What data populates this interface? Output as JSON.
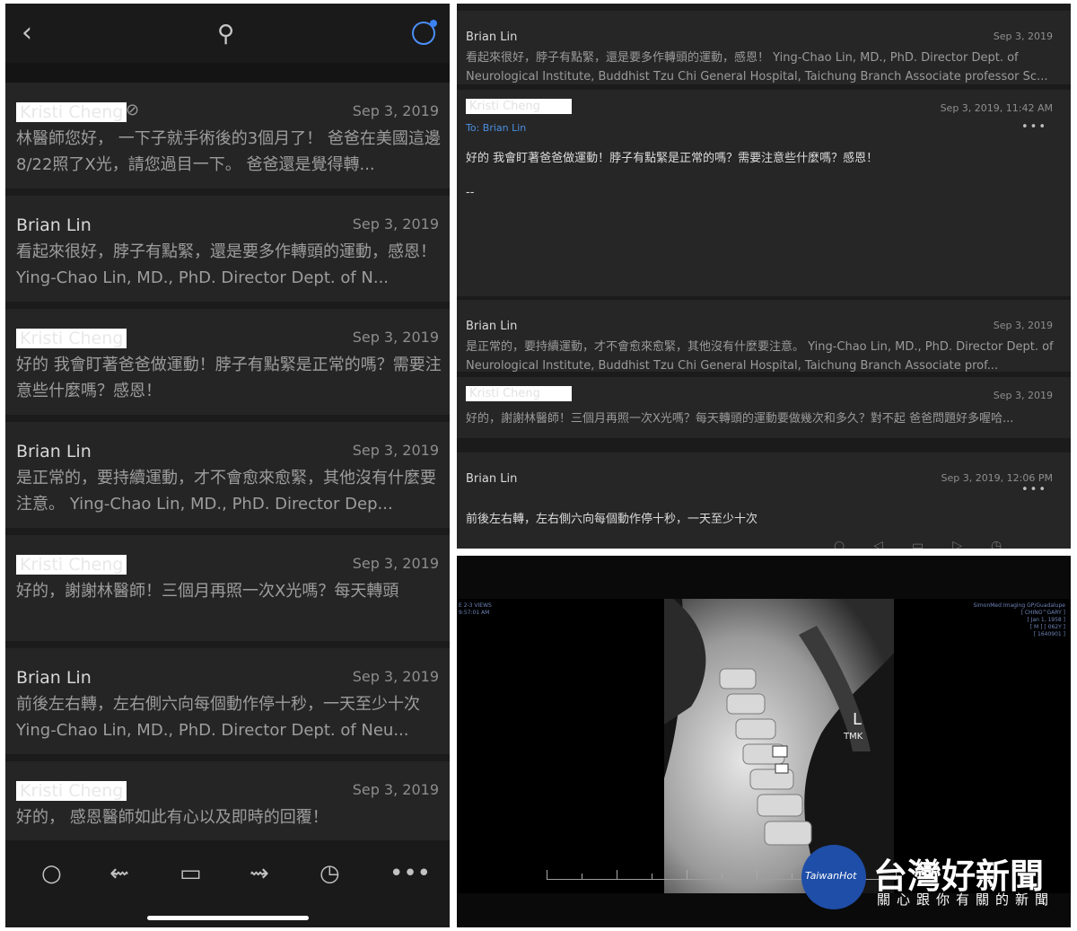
{
  "left": {
    "toolbar_icons": [
      "back-icon",
      "pin-icon",
      "account-icon"
    ],
    "rows": [
      {
        "sender": "Kristi Cheng",
        "redacted": true,
        "attachment": true,
        "date": "Sep 3, 2019",
        "preview": "林醫師您好， 一下子就手術後的3個月了！ 爸爸在美國這邊8/22照了X光，請您過目一下。 爸爸還是覺得轉..."
      },
      {
        "sender": "Brian Lin",
        "redacted": false,
        "attachment": false,
        "date": "Sep 3, 2019",
        "preview": "看起來很好，脖子有點緊，還是要多作轉頭的運動，感恩！ Ying-Chao Lin, MD., PhD. Director Dept. of N..."
      },
      {
        "sender": "Kristi Cheng",
        "redacted": true,
        "attachment": false,
        "date": "Sep 3, 2019",
        "preview": "好的 我會盯著爸爸做運動！脖子有點緊是正常的嗎？需要注意些什麼嗎？感恩！"
      },
      {
        "sender": "Brian Lin",
        "redacted": false,
        "attachment": false,
        "date": "Sep 3, 2019",
        "preview": "是正常的，要持續運動，才不會愈來愈緊，其他沒有什麼要注意。 Ying-Chao Lin, MD., PhD. Director Dep..."
      },
      {
        "sender": "Kristi Cheng",
        "redacted": true,
        "attachment": false,
        "date": "Sep 3, 2019",
        "preview": "好的，謝謝林醫師！三個月再照一次X光嗎？每天轉頭"
      },
      {
        "sender": "Brian Lin",
        "redacted": false,
        "attachment": false,
        "date": "Sep 3, 2019",
        "preview": "前後左右轉，左右側六向每個動作停十秒，一天至少十次 Ying-Chao Lin, MD., PhD. Director Dept. of Neu..."
      },
      {
        "sender": "Kristi Cheng",
        "redacted": true,
        "attachment": false,
        "date": "Sep 3, 2019",
        "preview": "好的， 感恩醫師如此有心以及即時的回覆！"
      }
    ],
    "bottom_icons": [
      "circle-icon",
      "reply-icon",
      "archive-icon",
      "forward-icon",
      "clock-icon",
      "more-icon"
    ]
  },
  "right_top": {
    "messages": [
      {
        "sender": "Brian Lin",
        "redacted": false,
        "date": "Sep 3, 2019",
        "body": "看起來很好，脖子有點緊，還是要多作轉頭的運動，感恩！ Ying-Chao Lin, MD., PhD. Director Dept. of Neurological Institute, Buddhist Tzu Chi General Hospital, Taichung Branch Associate professor Sc..."
      },
      {
        "sender": "Kristi Cheng",
        "redacted": true,
        "date": "Sep 3, 2019, 11:42 AM",
        "to": "To: Brian Lin",
        "body": "好的 我會盯著爸爸做運動！脖子有點緊是正常的嗎？需要注意些什麼嗎？感恩！",
        "signature": "--"
      },
      {
        "sender": "Brian Lin",
        "redacted": false,
        "date": "Sep 3, 2019",
        "body": "是正常的，要持續運動，才不會愈來愈緊，其他沒有什麼要注意。 Ying-Chao Lin, MD., PhD. Director Dept. of Neurological Institute, Buddhist Tzu Chi General Hospital, Taichung Branch Associate prof..."
      },
      {
        "sender": "Kristi Cheng",
        "redacted": true,
        "date": "Sep 3, 2019",
        "body": "好的，謝謝林醫師！三個月再照一次X光嗎？每天轉頭的運動要做幾次和多久？對不起 爸爸問題好多喔哈..."
      },
      {
        "sender": "Brian Lin",
        "redacted": false,
        "date": "Sep 3, 2019, 12:06 PM",
        "body": "前後左右轉，左右側六向每個動作停十秒，一天至少十次"
      }
    ]
  },
  "xray": {
    "meta_left": [
      "E 2-3 VIEWS",
      "9:57:01 AM"
    ],
    "meta_right": [
      "SimonMed Imaging GP/Guadalupe",
      "[ CHINO^GARY ]",
      "[ Jan 1, 1958 ]",
      "[ M ] [ 062Y ]",
      "[ 1640901 ]"
    ],
    "marker": "L",
    "marker_text": "TMK"
  },
  "watermark": {
    "logo_text": "TaiwanHot",
    "brand": "台灣好新聞",
    "tagline": "關心跟你有關的新聞",
    "logo_color": "#1f4ea8"
  }
}
